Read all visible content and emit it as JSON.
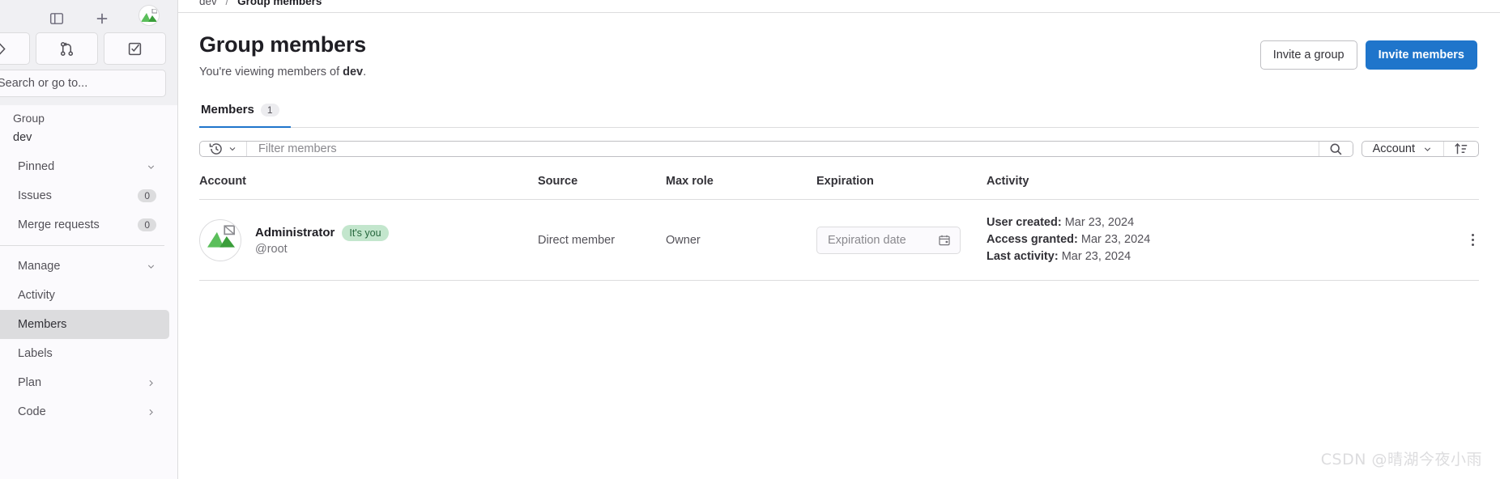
{
  "sidebar": {
    "top_icons": [
      "sidebar-toggle-icon",
      "plus-icon",
      "user-avatar-icon"
    ],
    "quick_actions": [
      "issues-icon",
      "merge-request-icon",
      "todo-checkbox-icon"
    ],
    "search": {
      "placeholder": "Search or go to..."
    },
    "group_label": "Group",
    "context_name": "dev",
    "items": [
      {
        "label": "Pinned",
        "type": "expandable",
        "chevron": "chevron-down",
        "count": null
      },
      {
        "label": "Issues",
        "type": "link",
        "chevron": null,
        "count": "0"
      },
      {
        "label": "Merge requests",
        "type": "link",
        "chevron": null,
        "count": "0"
      },
      {
        "label": "Manage",
        "type": "expandable",
        "chevron": "chevron-down",
        "count": null
      },
      {
        "label": "Activity",
        "type": "link",
        "chevron": null,
        "count": null
      },
      {
        "label": "Members",
        "type": "link",
        "chevron": null,
        "count": null,
        "active": true
      },
      {
        "label": "Labels",
        "type": "link",
        "chevron": null,
        "count": null
      },
      {
        "label": "Plan",
        "type": "expandable",
        "chevron": "chevron-right",
        "count": null
      },
      {
        "label": "Code",
        "type": "expandable",
        "chevron": "chevron-right",
        "count": null
      }
    ]
  },
  "breadcrumb": {
    "group": "dev",
    "separator": "/",
    "current": "Group members"
  },
  "header": {
    "title": "Group members",
    "subtitle_prefix": "You're viewing members of ",
    "subtitle_group": "dev",
    "subtitle_suffix": ".",
    "invite_group_label": "Invite a group",
    "invite_members_label": "Invite members"
  },
  "tabs": [
    {
      "label": "Members",
      "badge": "1",
      "active": true
    }
  ],
  "filter": {
    "history_icon": "history-icon",
    "placeholder": "Filter members",
    "value": "",
    "search_icon": "search-icon",
    "sort_field": "Account",
    "sort_direction_icon": "sort-ascending-icon"
  },
  "table": {
    "columns": [
      "Account",
      "Source",
      "Max role",
      "Expiration",
      "Activity"
    ],
    "rows": [
      {
        "avatar": "broken-image-icon",
        "name": "Administrator",
        "badge": "It's you",
        "handle": "@root",
        "source": "Direct member",
        "max_role": "Owner",
        "expiration_placeholder": "Expiration date",
        "expiration_value": "",
        "activity": {
          "created_label": "User created:",
          "created_value": "Mar 23, 2024",
          "granted_label": "Access granted:",
          "granted_value": "Mar 23, 2024",
          "last_label": "Last activity:",
          "last_value": "Mar 23, 2024"
        },
        "menu_icon": "kebab-menu-icon"
      }
    ]
  },
  "colors": {
    "primary": "#1f75cb",
    "badge_green_bg": "#c3e6cd",
    "badge_green_text": "#24663b",
    "border": "#dcdcde",
    "sidebar_bg": "#fbfafd"
  },
  "watermark": "CSDN @晴湖今夜小雨"
}
